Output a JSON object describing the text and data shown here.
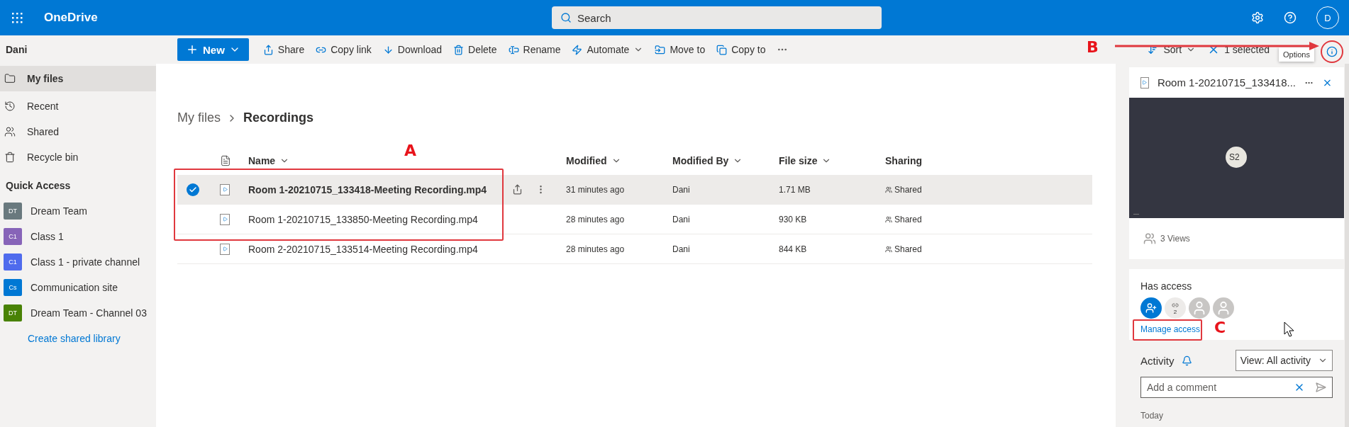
{
  "app": {
    "name": "OneDrive",
    "user_initial": "D"
  },
  "search": {
    "placeholder": "Search"
  },
  "sidebar": {
    "user": "Dani",
    "nav": [
      {
        "label": "My files",
        "selected": true
      },
      {
        "label": "Recent",
        "selected": false
      },
      {
        "label": "Shared",
        "selected": false
      },
      {
        "label": "Recycle bin",
        "selected": false
      }
    ],
    "quick_access_title": "Quick Access",
    "quick_access": [
      {
        "label": "Dream Team",
        "badge": "DT",
        "color": "#69797e"
      },
      {
        "label": "Class 1",
        "badge": "C1",
        "color": "#8764b8"
      },
      {
        "label": "Class 1 - private channel",
        "badge": "C1",
        "color": "#4f6bed"
      },
      {
        "label": "Communication site",
        "badge": "Cs",
        "color": "#0078d4"
      },
      {
        "label": "Dream Team - Channel 03",
        "badge": "DT",
        "color": "#498205"
      }
    ],
    "create_link": "Create shared library"
  },
  "command_bar": {
    "new": "New",
    "actions": [
      {
        "label": "Share",
        "dropdown": false
      },
      {
        "label": "Copy link",
        "dropdown": false
      },
      {
        "label": "Download",
        "dropdown": false
      },
      {
        "label": "Delete",
        "dropdown": false
      },
      {
        "label": "Rename",
        "dropdown": false
      },
      {
        "label": "Automate",
        "dropdown": true
      },
      {
        "label": "Move to",
        "dropdown": false
      },
      {
        "label": "Copy to",
        "dropdown": false
      }
    ],
    "sort": "Sort",
    "selection": "1 selected",
    "tooltip": "Options"
  },
  "breadcrumb": [
    "My files",
    "Recordings"
  ],
  "table": {
    "columns": [
      "Name",
      "Modified",
      "Modified By",
      "File size",
      "Sharing"
    ],
    "rows": [
      {
        "selected": true,
        "name": "Room 1-20210715_133418-Meeting Recording.mp4",
        "modified": "31 minutes ago",
        "modified_by": "Dani",
        "size": "1.71 MB",
        "sharing": "Shared"
      },
      {
        "selected": false,
        "name": "Room 1-20210715_133850-Meeting Recording.mp4",
        "modified": "28 minutes ago",
        "modified_by": "Dani",
        "size": "930 KB",
        "sharing": "Shared"
      },
      {
        "selected": false,
        "name": "Room 2-20210715_133514-Meeting Recording.mp4",
        "modified": "28 minutes ago",
        "modified_by": "Dani",
        "size": "844 KB",
        "sharing": "Shared"
      }
    ]
  },
  "details": {
    "title": "Room 1-20210715_133418...",
    "preview_badge": "S2",
    "views": "3 Views",
    "has_access_title": "Has access",
    "link_count": "2",
    "manage_access": "Manage access",
    "activity_title": "Activity",
    "activity_filter": "View: All activity",
    "comment_placeholder": "Add a comment",
    "today": "Today"
  },
  "annotations": [
    {
      "letter": "A"
    },
    {
      "letter": "B"
    },
    {
      "letter": "C"
    }
  ]
}
